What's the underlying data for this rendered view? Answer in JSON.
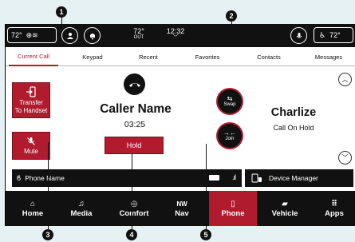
{
  "status_bar": {
    "left_temp": "72°",
    "out_temp": "72°",
    "out_label": "OUT",
    "time": "12:32",
    "right_temp": "72°"
  },
  "tabs": [
    {
      "label": "Current Call",
      "active": true
    },
    {
      "label": "Keypad",
      "active": false
    },
    {
      "label": "Recent",
      "active": false
    },
    {
      "label": "Favorites",
      "active": false
    },
    {
      "label": "Contacts",
      "active": false
    },
    {
      "label": "Messages",
      "active": false
    }
  ],
  "call": {
    "transfer_label_1": "Transfer",
    "transfer_label_2": "To Handset",
    "mute_label": "Mute",
    "caller_name": "Caller Name",
    "duration": "03:25",
    "hold_label": "Hold",
    "swap_label": "Swap",
    "join_label": "Join",
    "second_caller": "Charlize",
    "second_status": "Call On Hold"
  },
  "phone_bar": {
    "phone_name": "Phone Name",
    "device_manager": "Device Manager"
  },
  "nav": [
    {
      "label": "Home",
      "icon": "home-icon",
      "glyph": "⌂",
      "active": false
    },
    {
      "label": "Media",
      "icon": "music-note-icon",
      "glyph": "♫",
      "active": false
    },
    {
      "label": "Comfort",
      "icon": "steering-wheel-icon",
      "glyph": "◎",
      "active": false
    },
    {
      "label": "Nav",
      "icon": "compass-icon",
      "glyph": "NW",
      "active": false
    },
    {
      "label": "Phone",
      "icon": "phone-icon",
      "glyph": "▯",
      "active": true
    },
    {
      "label": "Vehicle",
      "icon": "vehicle-icon",
      "glyph": "▰",
      "active": false
    },
    {
      "label": "Apps",
      "icon": "apps-grid-icon",
      "glyph": "⠿",
      "active": false
    }
  ],
  "callouts": [
    "1",
    "2",
    "3",
    "4",
    "5"
  ],
  "colors": {
    "accent": "#b01c2e",
    "dark": "#111111",
    "background": "#e6f1f3"
  }
}
